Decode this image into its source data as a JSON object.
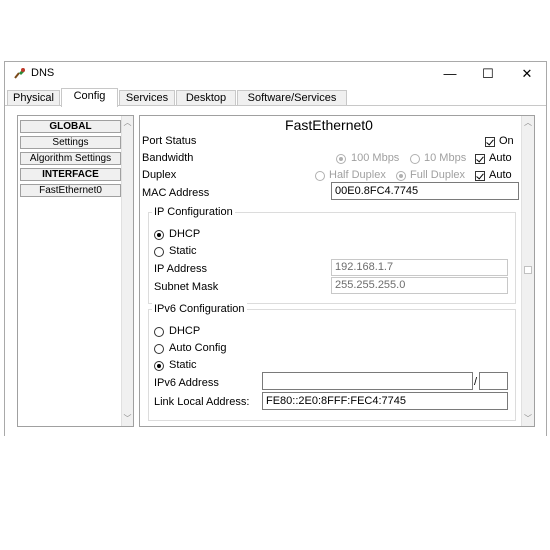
{
  "window": {
    "title": "DNS",
    "minimize": "—",
    "maximize": "☐",
    "close": "✕"
  },
  "tabs": [
    "Physical",
    "Config",
    "Services",
    "Desktop",
    "Software/Services"
  ],
  "active_tab": "Config",
  "sidebar": {
    "global_header": "GLOBAL",
    "settings": "Settings",
    "algorithm_settings": "Algorithm Settings",
    "interface_header": "INTERFACE",
    "interface_item": "FastEthernet0"
  },
  "panel": {
    "title": "FastEthernet0",
    "port_status_label": "Port Status",
    "port_status_on": "On",
    "bandwidth_label": "Bandwidth",
    "bw_100": "100 Mbps",
    "bw_10": "10 Mbps",
    "bw_auto": "Auto",
    "duplex_label": "Duplex",
    "half_duplex": "Half Duplex",
    "full_duplex": "Full Duplex",
    "duplex_auto": "Auto",
    "mac_label": "MAC Address",
    "mac_value": "00E0.8FC4.7745",
    "ip_config": {
      "title": "IP Configuration",
      "dhcp": "DHCP",
      "static": "Static",
      "selected": "DHCP",
      "ip_label": "IP Address",
      "ip_value": "192.168.1.7",
      "mask_label": "Subnet Mask",
      "mask_value": "255.255.255.0"
    },
    "ipv6_config": {
      "title": "IPv6 Configuration",
      "dhcp": "DHCP",
      "auto": "Auto Config",
      "static": "Static",
      "selected": "Static",
      "ipv6_label": "IPv6 Address",
      "ipv6_value": "",
      "prefix_sep": "/",
      "prefix_value": "",
      "link_local_label": "Link Local Address:",
      "link_local_value": "FE80::2E0:8FFF:FEC4:7745"
    }
  }
}
